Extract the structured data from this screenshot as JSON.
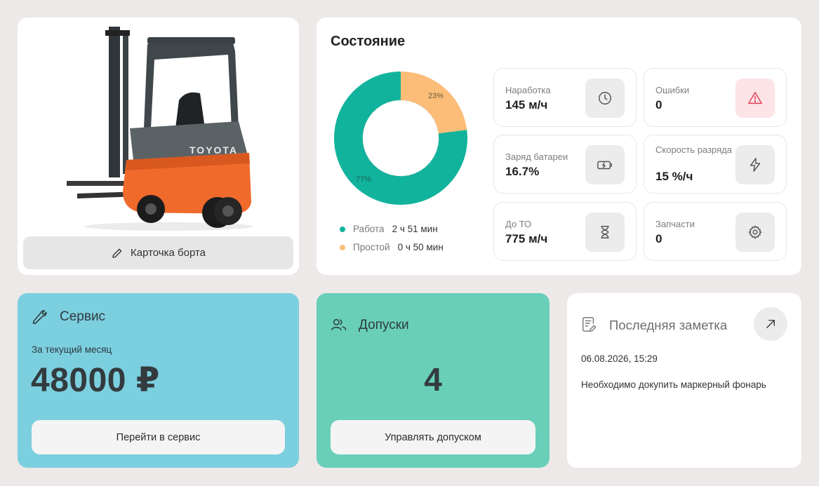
{
  "forklift": {
    "brand": "TOYOTA",
    "board_card_label": "Карточка борта"
  },
  "state": {
    "title": "Состояние",
    "donut": {
      "work_percent": 77,
      "idle_percent": 23,
      "work_label": "77%",
      "idle_label": "23%",
      "work_color": "#12b39c",
      "idle_color": "#fbbd77"
    },
    "legend": [
      {
        "label": "Работа",
        "value": "2 ч 51 мин",
        "color": "#12b39c"
      },
      {
        "label": "Простой",
        "value": "0 ч 50 мин",
        "color": "#fbbd77"
      }
    ],
    "metrics": {
      "runtime": {
        "label": "Наработка",
        "value": "145 м/ч",
        "icon": "clock-icon"
      },
      "errors": {
        "label": "Ошибки",
        "value": "0",
        "icon": "warning-icon"
      },
      "battery": {
        "label": "Заряд батареи",
        "value": "16.7%",
        "icon": "battery-icon"
      },
      "discharge": {
        "label": "Скорость разряда",
        "value": "15 %/ч",
        "icon": "lightning-icon"
      },
      "maintenance": {
        "label": "До ТО",
        "value": "775 м/ч",
        "icon": "hourglass-icon"
      },
      "parts": {
        "label": "Запчасти",
        "value": "0",
        "icon": "gear-icon"
      }
    }
  },
  "service": {
    "title": "Сервис",
    "subtitle": "За текущий месяц",
    "amount": "48000 ₽",
    "button": "Перейти в сервис",
    "color": "#7ccfdf"
  },
  "permits": {
    "title": "Допуски",
    "count": "4",
    "button": "Управлять допуском",
    "color": "#69cfb9"
  },
  "note": {
    "title": "Последняя заметка",
    "date": "06.08.2026, 15:29",
    "text": "Необходимо докупить маркерный фонарь"
  }
}
